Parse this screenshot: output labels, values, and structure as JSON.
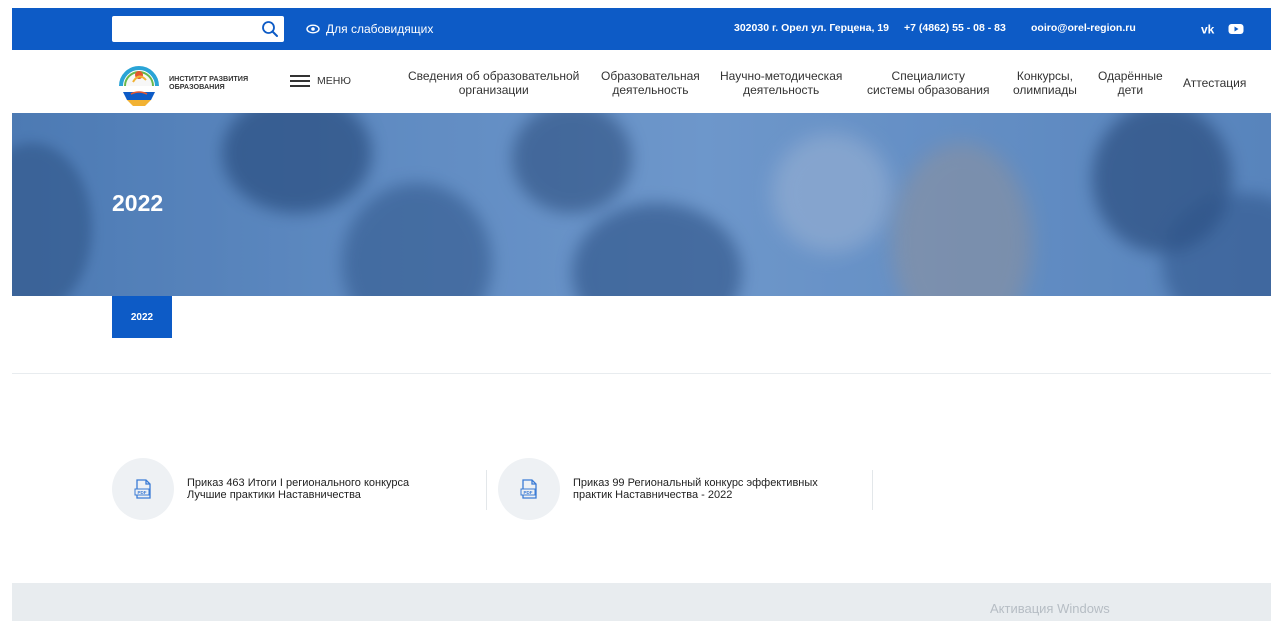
{
  "topbar": {
    "search_placeholder": "",
    "low_vision_label": "Для слабовидящих",
    "address": "302030 г. Орел ул. Герцена, 19",
    "phone": "+7 (4862) 55 - 08 - 83",
    "email": "ooiro@orel-region.ru"
  },
  "header": {
    "logo_text_line1": "ИНСТИТУТ РАЗВИТИЯ",
    "logo_text_line2": "ОБРАЗОВАНИЯ",
    "menu_label": "МЕНЮ",
    "nav": [
      {
        "line1": "Сведения об образовательной",
        "line2": "организации"
      },
      {
        "line1": "Образовательная",
        "line2": "деятельность"
      },
      {
        "line1": "Научно-методическая",
        "line2": "деятельность"
      },
      {
        "line1": "Специалисту",
        "line2": "системы образования"
      },
      {
        "line1": "Конкурсы,",
        "line2": "олимпиады"
      },
      {
        "line1": "Одарённые",
        "line2": "дети"
      },
      {
        "line1": "Аттестация",
        "line2": ""
      }
    ]
  },
  "hero": {
    "title": "2022"
  },
  "tabs": {
    "active": "2022"
  },
  "documents": [
    {
      "line1": "Приказ 463 Итоги I регионального конкурса",
      "line2": "Лучшие практики Наставничества",
      "icon": "pdf-icon"
    },
    {
      "line1": "Приказ 99 Региональный конкурс эффективных",
      "line2": "практик Наставничества - 2022",
      "icon": "pdf-icon"
    }
  ],
  "watermark": "Активация Windows",
  "colors": {
    "primary": "#0d5bc6",
    "text": "#222222",
    "light_bg": "#eef1f4",
    "footer_bg": "#e8ecef"
  }
}
